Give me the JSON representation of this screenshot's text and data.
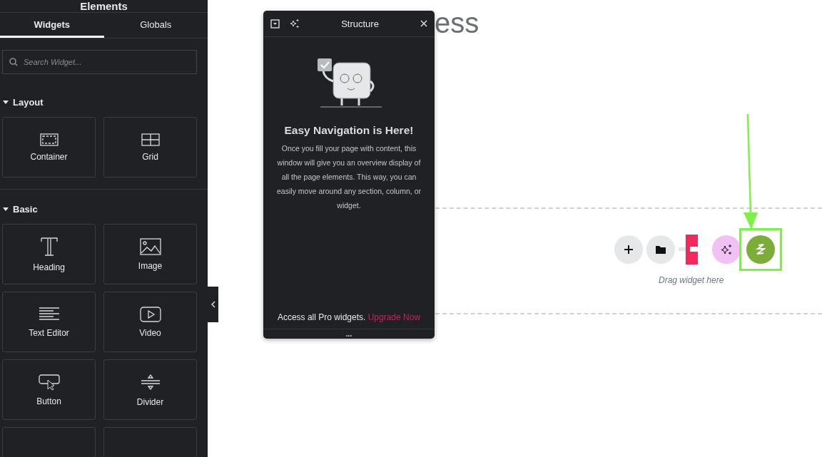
{
  "sidebar": {
    "title": "Elements",
    "tabs": [
      {
        "label": "Widgets",
        "selected": true
      },
      {
        "label": "Globals",
        "selected": false
      }
    ],
    "search": {
      "placeholder": "Search Widget..."
    },
    "sections": [
      {
        "title": "Layout",
        "expanded": true,
        "widgets": [
          {
            "kind": "container",
            "label": "Container"
          },
          {
            "kind": "grid",
            "label": "Grid"
          }
        ]
      },
      {
        "title": "Basic",
        "expanded": true,
        "widgets": [
          {
            "kind": "heading",
            "label": "Heading"
          },
          {
            "kind": "image",
            "label": "Image"
          },
          {
            "kind": "text",
            "label": "Text Editor"
          },
          {
            "kind": "video",
            "label": "Video"
          },
          {
            "kind": "button",
            "label": "Button"
          },
          {
            "kind": "divider",
            "label": "Divider"
          },
          {
            "kind": "blank"
          },
          {
            "kind": "blank"
          }
        ]
      }
    ]
  },
  "canvas": {
    "heading_fragment": "ess",
    "drop_hint": "Drag widget here",
    "actions": [
      {
        "kind": "add"
      },
      {
        "kind": "folder"
      },
      {
        "kind": "logo"
      },
      {
        "kind": "ai"
      },
      {
        "kind": "bolt",
        "highlighted": true
      }
    ]
  },
  "structure_panel": {
    "title": "Structure",
    "heading": "Easy Navigation is Here!",
    "body": "Once you fill your page with content, this window will give you an overview display of all the page elements. This way, you can easily move around any section, column, or widget.",
    "footer_text": "Access all Pro widgets.",
    "footer_link": "Upgrade Now",
    "more": "..."
  }
}
